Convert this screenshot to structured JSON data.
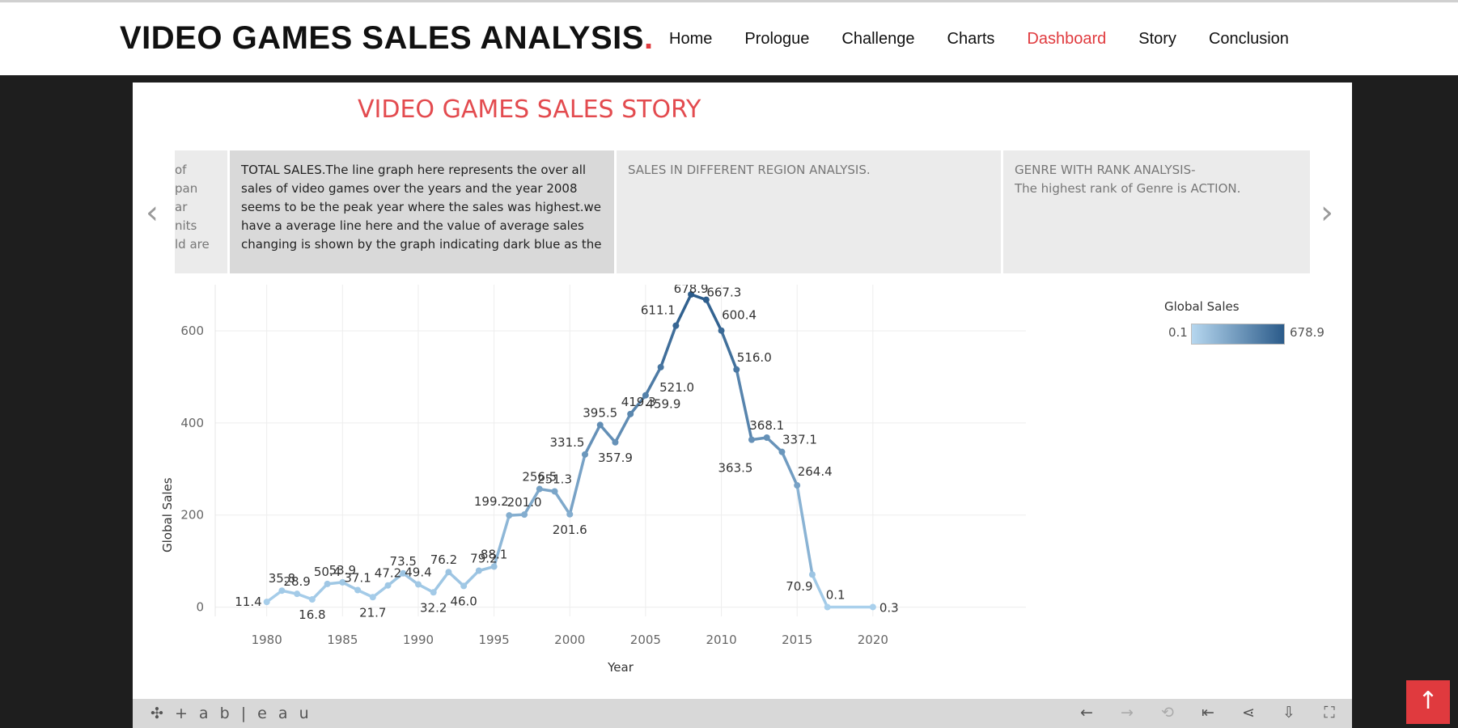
{
  "header": {
    "logo_text": "VIDEO GAMES SALES ANALYSIS",
    "logo_dot": ".",
    "nav": [
      {
        "label": "Home"
      },
      {
        "label": "Prologue"
      },
      {
        "label": "Challenge"
      },
      {
        "label": "Charts"
      },
      {
        "label": "Dashboard",
        "active": true
      },
      {
        "label": "Story"
      },
      {
        "label": "Conclusion"
      }
    ]
  },
  "story": {
    "title": "VIDEO GAMES SALES STORY",
    "prev_arrow": "‹",
    "next_arrow": "›",
    "points": {
      "prev_fragment": "of\npan\nar\nnits\nld are",
      "current": "TOTAL SALES.The line graph here represents the over all sales of video games over the years and the year 2008 seems to be the peak year where the sales was highest.we have a average line here and the value of average sales changing is shown by the graph indicating dark blue as the",
      "second": "SALES IN DIFFERENT REGION ANALYSIS.",
      "third": "GENRE WITH RANK ANALYSIS-\nThe highest rank of Genre is ACTION."
    }
  },
  "legend": {
    "title": "Global Sales",
    "min": "0.1",
    "max": "678.9"
  },
  "chart_data": {
    "type": "line",
    "xlabel": "Year",
    "ylabel": "Global Sales",
    "xlim": [
      1976.6,
      2030.1
    ],
    "ylim": [
      -20,
      700
    ],
    "x_ticks": [
      1980,
      1985,
      1990,
      1995,
      2000,
      2005,
      2010,
      2015,
      2020
    ],
    "y_ticks": [
      0,
      200,
      400,
      600
    ],
    "grid": true,
    "color_scale": {
      "min": 0.1,
      "max": 678.9,
      "low_color": "#a9d0ec",
      "high_color": "#2b5b8a"
    },
    "points": [
      {
        "x": 1980,
        "y": 11.4,
        "label": "11.4"
      },
      {
        "x": 1981,
        "y": 35.8,
        "label": "35.8"
      },
      {
        "x": 1982,
        "y": 28.9,
        "label": "28.9"
      },
      {
        "x": 1983,
        "y": 16.8,
        "label": "16.8"
      },
      {
        "x": 1984,
        "y": 50.4,
        "label": "50.4"
      },
      {
        "x": 1985,
        "y": 53.9,
        "label": "53.9"
      },
      {
        "x": 1986,
        "y": 37.1,
        "label": "37.1"
      },
      {
        "x": 1987,
        "y": 21.7,
        "label": "21.7"
      },
      {
        "x": 1988,
        "y": 47.2,
        "label": "47.2"
      },
      {
        "x": 1989,
        "y": 73.5,
        "label": "73.5"
      },
      {
        "x": 1990,
        "y": 49.4,
        "label": "49.4"
      },
      {
        "x": 1991,
        "y": 32.2,
        "label": "32.2"
      },
      {
        "x": 1992,
        "y": 76.2,
        "label": "76.2"
      },
      {
        "x": 1993,
        "y": 46.0,
        "label": "46.0"
      },
      {
        "x": 1994,
        "y": 79.2,
        "label": "79.2"
      },
      {
        "x": 1995,
        "y": 88.1,
        "label": "88.1"
      },
      {
        "x": 1996,
        "y": 199.2,
        "label": "199.2"
      },
      {
        "x": 1997,
        "y": 201.0,
        "label": "201.0"
      },
      {
        "x": 1998,
        "y": 256.5,
        "label": "256.5"
      },
      {
        "x": 1999,
        "y": 251.3,
        "label": "251.3"
      },
      {
        "x": 2000,
        "y": 201.6,
        "label": "201.6"
      },
      {
        "x": 2001,
        "y": 331.5,
        "label": "331.5"
      },
      {
        "x": 2002,
        "y": 395.5,
        "label": "395.5"
      },
      {
        "x": 2003,
        "y": 357.9,
        "label": "357.9"
      },
      {
        "x": 2004,
        "y": 419.3,
        "label": "419.3"
      },
      {
        "x": 2005,
        "y": 459.9,
        "label": "459.9"
      },
      {
        "x": 2006,
        "y": 521.0,
        "label": "521.0"
      },
      {
        "x": 2007,
        "y": 611.1,
        "label": "611.1"
      },
      {
        "x": 2008,
        "y": 678.9,
        "label": "678.9"
      },
      {
        "x": 2009,
        "y": 667.3,
        "label": "667.3"
      },
      {
        "x": 2010,
        "y": 600.4,
        "label": "600.4"
      },
      {
        "x": 2011,
        "y": 516.0,
        "label": "516.0"
      },
      {
        "x": 2012,
        "y": 363.5,
        "label": "363.5"
      },
      {
        "x": 2013,
        "y": 368.1,
        "label": "368.1"
      },
      {
        "x": 2014,
        "y": 337.1,
        "label": "337.1"
      },
      {
        "x": 2015,
        "y": 264.4,
        "label": "264.4"
      },
      {
        "x": 2016,
        "y": 70.9,
        "label": "70.9"
      },
      {
        "x": 2017,
        "y": 0.1,
        "label": "0.1"
      },
      {
        "x": 2020,
        "y": 0.3,
        "label": "0.3"
      }
    ]
  },
  "toolbar": {
    "logo": "+ a b | e a u",
    "icons": [
      {
        "name": "undo-icon",
        "glyph": "←",
        "enabled": true
      },
      {
        "name": "redo-icon",
        "glyph": "→",
        "enabled": false
      },
      {
        "name": "revert-icon",
        "glyph": "⟲",
        "enabled": false
      },
      {
        "name": "reset-icon",
        "glyph": "⇤",
        "enabled": true
      },
      {
        "name": "share-icon",
        "glyph": "⋖",
        "enabled": true
      },
      {
        "name": "download-icon",
        "glyph": "⇩",
        "enabled": true
      },
      {
        "name": "fullscreen-icon",
        "glyph": "⛶",
        "enabled": true
      }
    ]
  },
  "back_to_top": {
    "glyph": "↑"
  }
}
